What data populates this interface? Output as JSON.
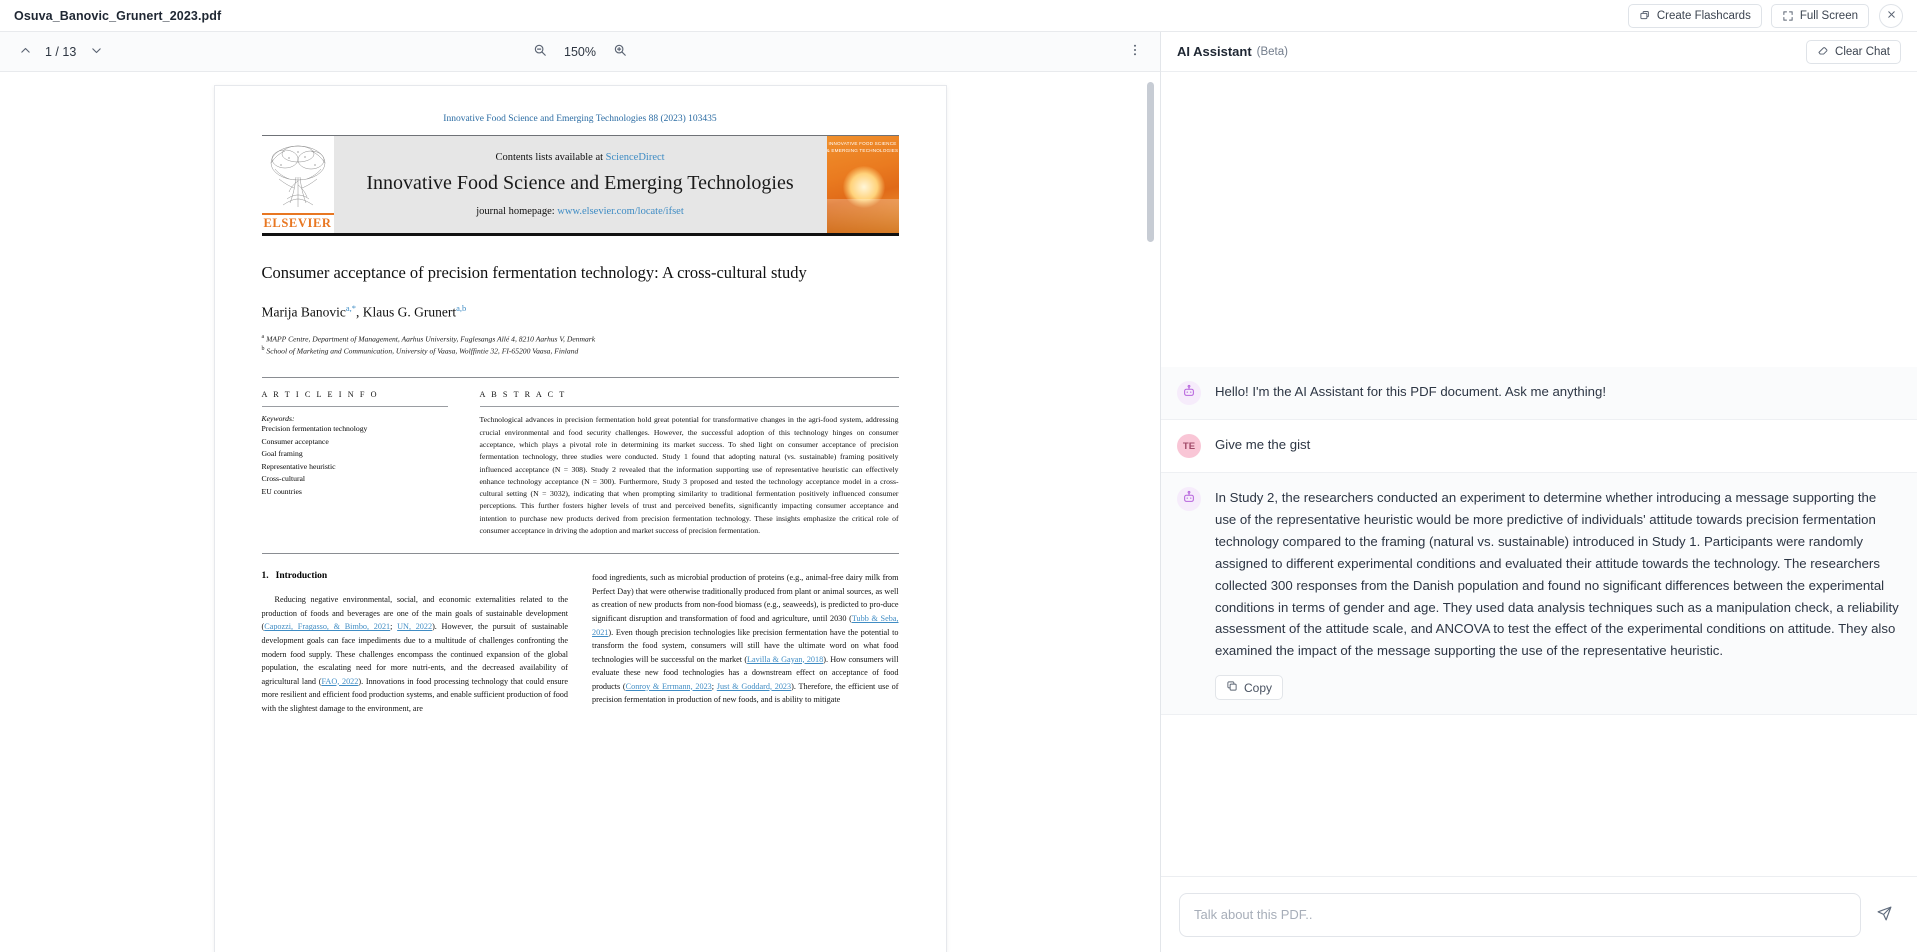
{
  "topbar": {
    "doc_title": "Osuva_Banovic_Grunert_2023.pdf",
    "create_flashcards_label": "Create Flashcards",
    "full_screen_label": "Full Screen"
  },
  "viewer_toolbar": {
    "page_indicator": "1 / 13",
    "zoom_level": "150%"
  },
  "pdf": {
    "journal_header": "Innovative Food Science and Emerging Technologies 88 (2023) 103435",
    "contents_prefix": "Contents lists available at ",
    "contents_link": "ScienceDirect",
    "journal_name": "Innovative Food Science and Emerging Technologies",
    "homepage_prefix": "journal homepage: ",
    "homepage_link": "www.elsevier.com/locate/ifset",
    "publisher": "ELSEVIER",
    "cover_art_title": "INNOVATIVE FOOD SCIENCE & EMERGING TECHNOLOGIES",
    "title": "Consumer acceptance of precision fermentation technology: A cross-cultural study",
    "authors_1": "Marija Banovic",
    "authors_1_sup": "a,*",
    "authors_sep": ", ",
    "authors_2": "Klaus G. Grunert",
    "authors_2_sup": "a,b",
    "affiliation_a_marker": "a",
    "affiliation_a": "MAPP Centre, Department of Management, Aarhus University, Fuglesangs Allé 4, 8210 Aarhus V, Denmark",
    "affiliation_b_marker": "b",
    "affiliation_b": "School of Marketing and Communication, University of Vaasa, Wolffintie 32, FI-65200 Vaasa, Finland",
    "article_info_head": "A R T I C L E  I N F O",
    "abstract_head": "A B S T R A C T",
    "keywords_label": "Keywords:",
    "keywords": [
      "Precision fermentation technology",
      "Consumer acceptance",
      "Goal framing",
      "Representative heuristic",
      "Cross-cultural",
      "EU countries"
    ],
    "abstract": "Technological advances in precision fermentation hold great potential for transformative changes in the agri-food system, addressing crucial environmental and food security challenges. However, the successful adoption of this technology hinges on consumer acceptance, which plays a pivotal role in determining its market success. To shed light on consumer acceptance of precision fermentation technology, three studies were conducted. Study 1 found that adopting natural (vs. sustainable) framing positively influenced acceptance (N = 308). Study 2 revealed that the information supporting use of representative heuristic can effectively enhance technology acceptance (N = 300). Furthermore, Study 3 proposed and tested the technology acceptance model in a cross-cultural setting (N = 3032), indicating that when prompting similarity to traditional fermentation positively influenced consumer perceptions. This further fosters higher levels of trust and perceived benefits, significantly impacting consumer acceptance and intention to purchase new products derived from precision fermentation technology. These insights emphasize the critical role of consumer acceptance in driving the adoption and market success of precision fermentation.",
    "intro_number": "1.",
    "intro_title": "Introduction",
    "intro_col1_p1_a": "Reducing negative environmental, social, and economic externalities related to the production of foods and beverages are one of the main goals of sustainable development (",
    "intro_col1_cite1": "Capozzi, Fragasso, & Bimbo, 2021",
    "intro_col1_semi": "; ",
    "intro_col1_cite2": "UN, 2022",
    "intro_col1_p1_b": "). However, the pursuit of sustainable development goals can face impediments due to a multitude of challenges confronting the modern food supply. These challenges encompass the continued expansion of the global population, the escalating need for more nutri-ents, and the decreased availability of agricultural land (",
    "intro_col1_cite3": "FAO, 2022",
    "intro_col1_p1_c": "). Innovations in food processing technology that could ensure more resilient and efficient food production systems, and enable sufficient production of food with the slightest damage to the environment, are",
    "intro_col2_a": "food ingredients, such as microbial production of proteins (e.g., animal-free dairy milk from Perfect Day) that were otherwise traditionally produced from plant or animal sources, as well as creation of new products from non-food biomass (e.g., seaweeds), is predicted to pro-duce significant disruption and transformation of food and agriculture, until 2030 (",
    "intro_col2_cite1": "Tubb & Seba, 2021",
    "intro_col2_b": "). Even though precision technologies like precision fermentation have the potential to transform the food system, consumers will still have the ultimate word on what food technologies will be successful on the market (",
    "intro_col2_cite2": "Lavilla & Gayan, 2018",
    "intro_col2_c": "). How consumers will evaluate these new food technologies has a downstream effect on acceptance of food products (",
    "intro_col2_cite3": "Conroy & Errmann, 2023",
    "intro_col2_semi": "; ",
    "intro_col2_cite4": "Just & Goddard, 2023",
    "intro_col2_d": "). Therefore, the efficient use of precision fermentation in production of new foods, and is ability to mitigate"
  },
  "ai_panel": {
    "title": "AI Assistant",
    "beta": "(Beta)",
    "clear_chat_label": "Clear Chat",
    "messages": [
      {
        "role": "bot",
        "avatar": "robot-icon",
        "text": "Hello! I'm the AI Assistant for this PDF document. Ask me anything!"
      },
      {
        "role": "user",
        "avatar": "TE",
        "text": "Give me the gist"
      },
      {
        "role": "bot",
        "avatar": "robot-icon",
        "text": "In Study 2, the researchers conducted an experiment to determine whether introducing a message supporting the use of the representative heuristic would be more predictive of individuals' attitude towards precision fermentation technology compared to the framing (natural vs. sustainable) introduced in Study 1. Participants were randomly assigned to different experimental conditions and evaluated their attitude towards the technology. The researchers collected 300 responses from the Danish population and found no significant differences between the experimental conditions in terms of gender and age. They used data analysis techniques such as a manipulation check, a reliability assessment of the attitude scale, and ANCOVA to test the effect of the experimental conditions on attitude. They also examined the impact of the message supporting the use of the representative heuristic.",
        "copy_label": "Copy"
      }
    ],
    "composer_placeholder": "Talk about this PDF.."
  },
  "colors": {
    "link": "#3f8cc4",
    "elsevier_orange": "#e87722",
    "bot_avatar_bg": "#f6ecfb",
    "user_avatar_bg": "#f9c6d6"
  }
}
